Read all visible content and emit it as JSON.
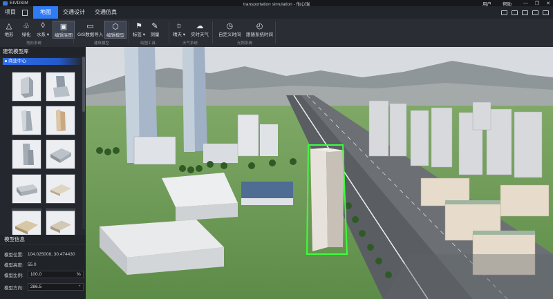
{
  "app": {
    "name": "EIVDSIM",
    "window_title": "transportation simulation - 他心瑞",
    "user_label": "用户",
    "help_label": "帮助"
  },
  "menu": {
    "items": [
      {
        "label": "项目"
      },
      {
        "label": "地图"
      },
      {
        "label": "交通设计"
      },
      {
        "label": "交通仿真"
      }
    ],
    "active": "地图"
  },
  "toolbar": {
    "buttons": [
      {
        "label": "地形",
        "icon": "terrain-icon"
      },
      {
        "label": "绿化",
        "icon": "tree-icon"
      },
      {
        "label": "水系 ▾",
        "icon": "water-icon"
      },
      {
        "label": "编辑底图",
        "icon": "basemap-icon"
      },
      {
        "label": "GIS数据导入",
        "icon": "gis-import-icon"
      },
      {
        "label": "编辑模型",
        "icon": "cube-icon"
      },
      {
        "label": "标签 ▾",
        "icon": "flag-icon"
      },
      {
        "label": "测量",
        "icon": "ruler-icon"
      },
      {
        "label": "晴天 ▾",
        "icon": "sun-icon"
      },
      {
        "label": "实时天气",
        "icon": "cloud-icon"
      },
      {
        "label": "自定义时间",
        "icon": "clock-icon"
      },
      {
        "label": "跟随系统时间",
        "icon": "clock-sync-icon"
      }
    ],
    "groups": [
      "地形系统",
      "建筑模型",
      "绘图工具",
      "天气系统",
      "光照系统"
    ]
  },
  "library": {
    "title": "建筑模型库",
    "category": "商业中心"
  },
  "model_info": {
    "title": "模型信息",
    "position_label": "模型位置:",
    "position_value": "104.025008,  30.474430",
    "height_label": "模型高度:",
    "height_value": "55.0",
    "scale_label": "模型比例:",
    "scale_value": "100.0",
    "scale_unit": "%",
    "direction_label": "模型方向:",
    "direction_value": "286.5"
  },
  "colors": {
    "accent": "#2f7bf5",
    "selection_outline": "#3cff3c"
  }
}
